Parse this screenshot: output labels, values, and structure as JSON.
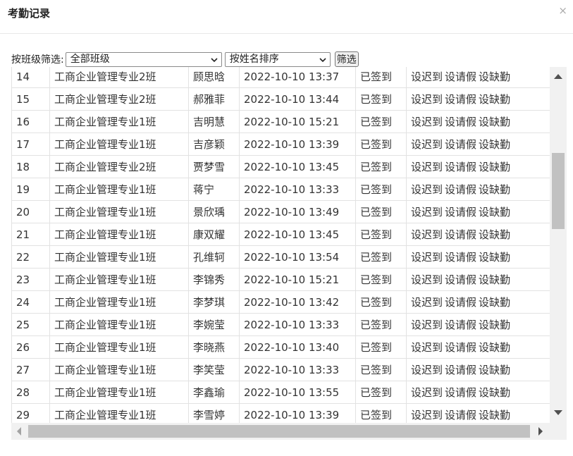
{
  "dialog": {
    "title": "考勤记录",
    "close_icon": "×"
  },
  "filter": {
    "label": "按班级筛选:",
    "class_select": "全部班级",
    "sort_select": "按姓名排序",
    "button": "筛选"
  },
  "actions": {
    "late": "设迟到",
    "leave": "设请假",
    "absent": "设缺勤"
  },
  "rows": [
    {
      "no": "14",
      "cls": "工商企业管理专业2班",
      "name": "顾思晗",
      "time": "2022-10-10 13:37",
      "status": "已签到"
    },
    {
      "no": "15",
      "cls": "工商企业管理专业2班",
      "name": "郝雅菲",
      "time": "2022-10-10 13:44",
      "status": "已签到"
    },
    {
      "no": "16",
      "cls": "工商企业管理专业1班",
      "name": "吉明慧",
      "time": "2022-10-10 15:21",
      "status": "已签到"
    },
    {
      "no": "17",
      "cls": "工商企业管理专业1班",
      "name": "吉彦颖",
      "time": "2022-10-10 13:39",
      "status": "已签到"
    },
    {
      "no": "18",
      "cls": "工商企业管理专业2班",
      "name": "贾梦雪",
      "time": "2022-10-10 13:45",
      "status": "已签到"
    },
    {
      "no": "19",
      "cls": "工商企业管理专业1班",
      "name": "蒋宁",
      "time": "2022-10-10 13:33",
      "status": "已签到"
    },
    {
      "no": "20",
      "cls": "工商企业管理专业1班",
      "name": "景欣瑀",
      "time": "2022-10-10 13:49",
      "status": "已签到"
    },
    {
      "no": "21",
      "cls": "工商企业管理专业1班",
      "name": "康双耀",
      "time": "2022-10-10 13:45",
      "status": "已签到"
    },
    {
      "no": "22",
      "cls": "工商企业管理专业1班",
      "name": "孔维轲",
      "time": "2022-10-10 13:54",
      "status": "已签到"
    },
    {
      "no": "23",
      "cls": "工商企业管理专业1班",
      "name": "李锦秀",
      "time": "2022-10-10 15:21",
      "status": "已签到"
    },
    {
      "no": "24",
      "cls": "工商企业管理专业1班",
      "name": "李梦琪",
      "time": "2022-10-10 13:42",
      "status": "已签到"
    },
    {
      "no": "25",
      "cls": "工商企业管理专业1班",
      "name": "李婉莹",
      "time": "2022-10-10 13:33",
      "status": "已签到"
    },
    {
      "no": "26",
      "cls": "工商企业管理专业1班",
      "name": "李晓燕",
      "time": "2022-10-10 13:40",
      "status": "已签到"
    },
    {
      "no": "27",
      "cls": "工商企业管理专业1班",
      "name": "李笑莹",
      "time": "2022-10-10 13:33",
      "status": "已签到"
    },
    {
      "no": "28",
      "cls": "工商企业管理专业1班",
      "name": "李鑫瑜",
      "time": "2022-10-10 13:55",
      "status": "已签到"
    },
    {
      "no": "29",
      "cls": "工商企业管理专业1班",
      "name": "李雪婷",
      "time": "2022-10-10 13:39",
      "status": "已签到"
    }
  ],
  "colors": {
    "time_text": "#2e8b2e",
    "border": "#e2e2e2"
  }
}
